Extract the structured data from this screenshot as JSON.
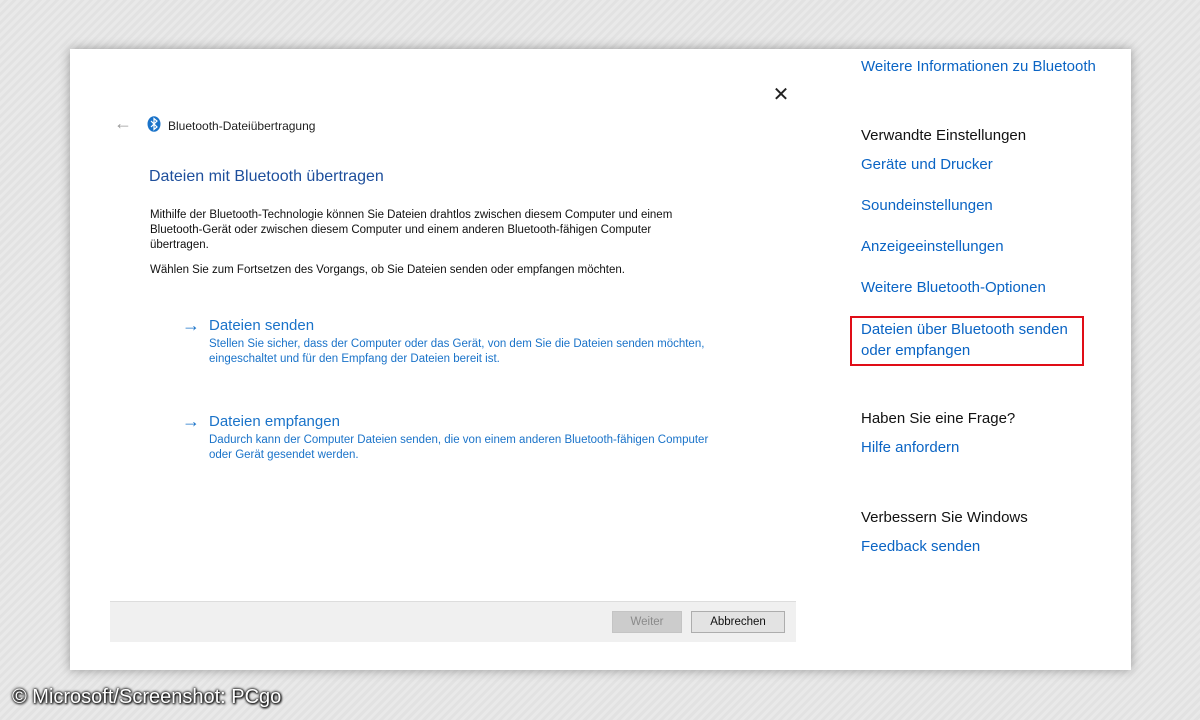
{
  "dialog": {
    "title": "Bluetooth-Dateiübertragung",
    "heading": "Dateien mit Bluetooth übertragen",
    "description": "Mithilfe der Bluetooth-Technologie können Sie Dateien drahtlos zwischen diesem Computer und einem Bluetooth-Gerät oder zwischen diesem Computer und einem anderen Bluetooth-fähigen Computer übertragen.",
    "prompt": "Wählen Sie zum Fortsetzen des Vorgangs, ob Sie Dateien senden oder empfangen möchten.",
    "options": [
      {
        "title": "Dateien senden",
        "description": "Stellen Sie sicher, dass der Computer oder das Gerät, von dem Sie die Dateien senden möchten, eingeschaltet und für den Empfang der Dateien bereit ist."
      },
      {
        "title": "Dateien empfangen",
        "description": "Dadurch kann der Computer Dateien senden, die von einem anderen Bluetooth-fähigen Computer oder Gerät gesendet werden."
      }
    ],
    "next_label": "Weiter",
    "cancel_label": "Abbrechen",
    "back_icon": "back-arrow-icon",
    "close_icon": "close-icon",
    "bluetooth_icon": "bluetooth-icon"
  },
  "settings": {
    "more_info_link": "Weitere Informationen zu Bluetooth",
    "related_heading": "Verwandte Einstellungen",
    "related_links": [
      "Geräte und Drucker",
      "Soundeinstellungen",
      "Anzeigeeinstellungen",
      "Weitere Bluetooth-Optionen"
    ],
    "send_receive_link_line1": "Dateien über Bluetooth senden",
    "send_receive_link_line2": "oder empfangen",
    "question_heading": "Haben Sie eine Frage?",
    "help_link": "Hilfe anfordern",
    "improve_heading": "Verbessern Sie Windows",
    "feedback_link": "Feedback senden"
  },
  "colors": {
    "link": "#0a64c4",
    "highlight": "#e00d17",
    "heading": "#1e4f9c"
  },
  "watermark": "© Microsoft/Screenshot: PCgo"
}
